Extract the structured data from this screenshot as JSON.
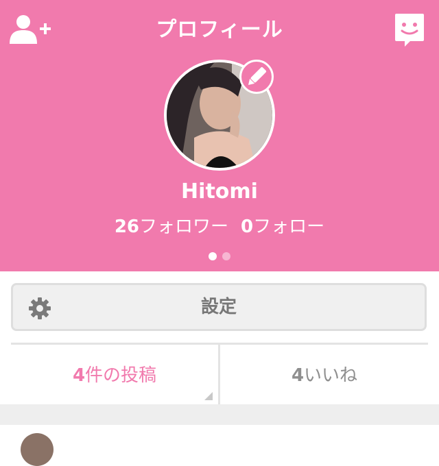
{
  "header": {
    "title": "プロフィール",
    "bg_color": "#F17AAD",
    "left_icon": "add-user-icon",
    "right_icon": "chat-smile-icon"
  },
  "profile": {
    "username": "Hitomi",
    "followers_count": "26",
    "followers_label": "フォロワー",
    "following_count": "0",
    "following_label": "フォロー",
    "edit_icon": "pencil-icon",
    "page_indicator": {
      "current": 1,
      "total": 2
    }
  },
  "settings": {
    "label": "設定",
    "icon": "gear-icon"
  },
  "tabs": {
    "posts": {
      "count": "4",
      "label": "件の投稿",
      "color": "#F17AAD"
    },
    "likes": {
      "count": "4",
      "label": "いいね",
      "color": "#8f8f8f"
    }
  }
}
